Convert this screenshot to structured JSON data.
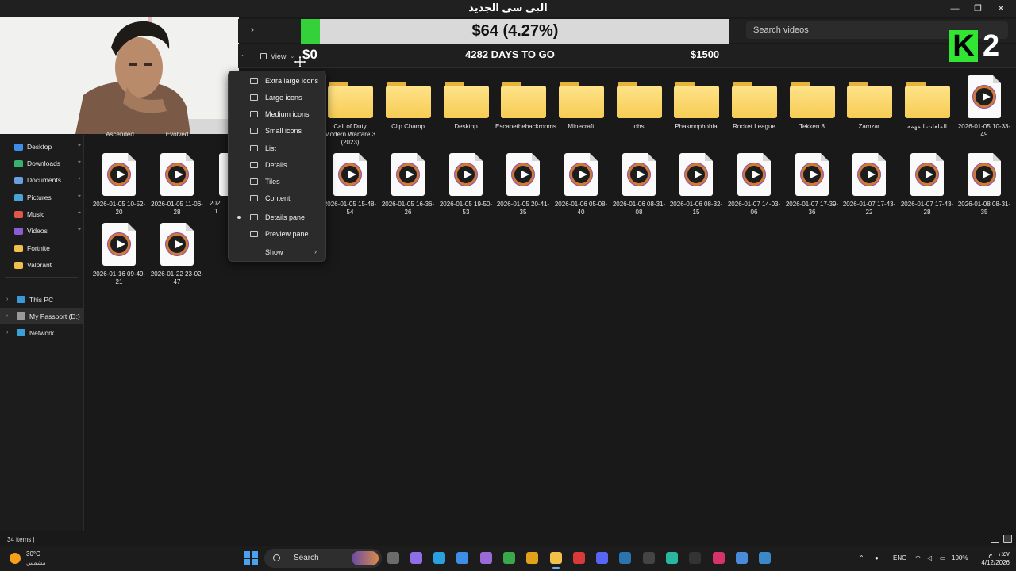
{
  "window": {
    "title": "البي سي الجديد",
    "minimize": "—",
    "restore": "❐",
    "close": "✕"
  },
  "search": {
    "placeholder": "Search videos"
  },
  "toolbar": {
    "view_label": "View"
  },
  "overlay": {
    "progress_text": "$64 (4.27%)",
    "progress_fraction": 0.0427,
    "low_label": "$0",
    "days_label": "4282 DAYS TO GO",
    "high_label": "$1500",
    "fill_color": "#34d13a",
    "logo_letter": "K",
    "logo_number": "2"
  },
  "sidebar": {
    "quick_access": [
      {
        "label": "Desktop",
        "icon": "desktop-icon",
        "color": "#3d8ee8"
      },
      {
        "label": "Downloads",
        "icon": "download-icon",
        "color": "#3ab06e"
      },
      {
        "label": "Documents",
        "icon": "documents-icon",
        "color": "#6a9ee0"
      },
      {
        "label": "Pictures",
        "icon": "pictures-icon",
        "color": "#4aa3d8"
      },
      {
        "label": "Music",
        "icon": "music-icon",
        "color": "#e0564a"
      },
      {
        "label": "Videos",
        "icon": "videos-icon",
        "color": "#8a5cd6"
      },
      {
        "label": "Fortnite",
        "icon": "folder-icon",
        "color": "#f0c04a"
      },
      {
        "label": "Valorant",
        "icon": "folder-icon",
        "color": "#f0c04a"
      }
    ],
    "tree": [
      {
        "label": "This PC",
        "icon": "computer-icon"
      },
      {
        "label": "My Passport (D:)",
        "icon": "drive-icon"
      },
      {
        "label": "Network",
        "icon": "network-icon"
      }
    ]
  },
  "view_menu": {
    "items": [
      {
        "label": "Extra large icons",
        "icon": "extra-large-icons-icon"
      },
      {
        "label": "Large icons",
        "icon": "large-icons-icon"
      },
      {
        "label": "Medium icons",
        "icon": "medium-icons-icon"
      },
      {
        "label": "Small icons",
        "icon": "small-icons-icon"
      },
      {
        "label": "List",
        "icon": "list-icon"
      },
      {
        "label": "Details",
        "icon": "details-icon"
      },
      {
        "label": "Tiles",
        "icon": "tiles-icon"
      },
      {
        "label": "Content",
        "icon": "content-icon"
      }
    ],
    "panes": [
      {
        "label": "Details pane",
        "checked": true
      },
      {
        "label": "Preview pane",
        "checked": false
      }
    ],
    "show_label": "Show"
  },
  "content": {
    "partial_labels": [
      "Ascended",
      "Evolved"
    ],
    "row1": [
      {
        "type": "folder",
        "label": "Call of Duty Modern Warfare 3 (2023)"
      },
      {
        "type": "folder",
        "label": "Clip Champ"
      },
      {
        "type": "folder",
        "label": "Desktop"
      },
      {
        "type": "folder",
        "label": "Escapethebackrooms"
      },
      {
        "type": "folder",
        "label": "Minecraft"
      },
      {
        "type": "folder",
        "label": "obs"
      },
      {
        "type": "folder",
        "label": "Phasmophobia"
      },
      {
        "type": "folder",
        "label": "Rocket League"
      },
      {
        "type": "folder",
        "label": "Tekken 8"
      },
      {
        "type": "folder",
        "label": "Zamzar"
      },
      {
        "type": "folder",
        "label": "الملفات المهمه"
      },
      {
        "type": "video",
        "label": "2026-01-05 10-33-49"
      }
    ],
    "row2_left": [
      {
        "type": "video",
        "label": "2026-01-05 10-52-20"
      },
      {
        "type": "video",
        "label": "2026-01-05 11-06-28"
      }
    ],
    "row2_partial": "202",
    "row2_partial_2": "1",
    "row2": [
      {
        "type": "video",
        "label": "2026-01-05 15-48-54"
      },
      {
        "type": "video",
        "label": "2026-01-05 16-36-26"
      },
      {
        "type": "video",
        "label": "2026-01-05 19-50-53"
      },
      {
        "type": "video",
        "label": "2026-01-05 20-41-35"
      },
      {
        "type": "video",
        "label": "2026-01-06 05-08-40"
      },
      {
        "type": "video",
        "label": "2026-01-06 08-31-08"
      },
      {
        "type": "video",
        "label": "2026-01-06 08-32-15"
      },
      {
        "type": "video",
        "label": "2026-01-07 14-03-06"
      },
      {
        "type": "video",
        "label": "2026-01-07 17-39-36"
      },
      {
        "type": "video",
        "label": "2026-01-07 17-43-22"
      },
      {
        "type": "video",
        "label": "2026-01-07 17-43-28"
      },
      {
        "type": "video",
        "label": "2026-01-08 08-31-35"
      }
    ],
    "row3": [
      {
        "type": "video",
        "label": "2026-01-16 09-49-21"
      },
      {
        "type": "video",
        "label": "2026-01-22 23-02-47"
      }
    ]
  },
  "status": {
    "item_count": "34 items  |"
  },
  "taskbar": {
    "weather_temp": "30°C",
    "weather_desc": "مشمس",
    "search_label": "Search",
    "language": "ENG",
    "battery": "100%",
    "time": "٠١:٤٧ م",
    "date": "4/12/2026",
    "apps": [
      {
        "icon": "task-view-icon",
        "color": "#6b6b6b"
      },
      {
        "icon": "copilot-icon",
        "color": "#8f6ee8"
      },
      {
        "icon": "edge-icon",
        "color": "#2aa0e0"
      },
      {
        "icon": "store-icon",
        "color": "#3d8ee8"
      },
      {
        "icon": "app-icon",
        "color": "#9a6ad8"
      },
      {
        "icon": "xbox-icon",
        "color": "#3aa84a"
      },
      {
        "icon": "chrome-icon",
        "color": "#e0a21a"
      },
      {
        "icon": "file-explorer-icon",
        "color": "#f0c04a"
      },
      {
        "icon": "app-red-icon",
        "color": "#d83a3a"
      },
      {
        "icon": "discord-icon",
        "color": "#5865f2"
      },
      {
        "icon": "steam-icon",
        "color": "#2a75b0"
      },
      {
        "icon": "app-g-icon",
        "color": "#444444"
      },
      {
        "icon": "app-teal-icon",
        "color": "#2ab7a0"
      },
      {
        "icon": "epic-games-icon",
        "color": "#333333"
      },
      {
        "icon": "instagram-icon",
        "color": "#d6336c"
      },
      {
        "icon": "app-a-icon",
        "color": "#4a8ad8"
      },
      {
        "icon": "steam-2-icon",
        "color": "#3c88c8"
      }
    ]
  }
}
